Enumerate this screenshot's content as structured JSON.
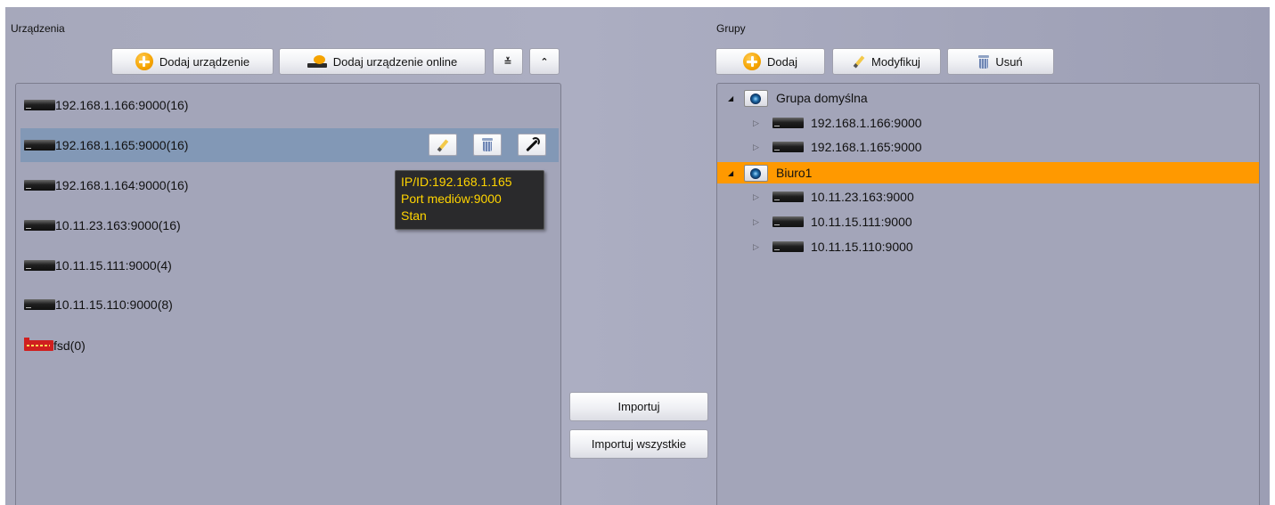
{
  "left": {
    "title": "Urządzenia",
    "add_device_label": "Dodaj urządzenie",
    "add_online_label": "Dodaj urządzenie online",
    "expand_glyph": "≚",
    "collapse_glyph": "⌃",
    "devices": [
      {
        "label": "192.168.1.166:9000(16)",
        "icon": "nvr-icon"
      },
      {
        "label": "192.168.1.165:9000(16)",
        "icon": "nvr-icon",
        "selected": true
      },
      {
        "label": "192.168.1.164:9000(16)",
        "icon": "nvr-icon"
      },
      {
        "label": "10.11.23.163:9000(16)",
        "icon": "nvr-icon"
      },
      {
        "label": "10.11.15.111:9000(4)",
        "icon": "nvr-icon"
      },
      {
        "label": "10.11.15.110:9000(8)",
        "icon": "nvr-icon"
      },
      {
        "label": "fsd(0)",
        "icon": "dvr-icon"
      }
    ],
    "tooltip": {
      "line1": "IP/ID:192.168.1.165",
      "line2": "Port mediów:9000",
      "line3": "Stan"
    }
  },
  "middle": {
    "import_label": "Importuj",
    "import_all_label": "Importuj wszystkie"
  },
  "right": {
    "title": "Grupy",
    "add_label": "Dodaj",
    "modify_label": "Modyfikuj",
    "delete_label": "Usuń",
    "groups": [
      {
        "name": "Grupa domyślna",
        "devices": [
          "192.168.1.166:9000",
          "192.168.1.165:9000"
        ]
      },
      {
        "name": "Biuro1",
        "selected": true,
        "devices": [
          "10.11.23.163:9000",
          "10.11.15.111:9000",
          "10.11.15.110:9000"
        ]
      }
    ]
  },
  "colors": {
    "selection_row": "#8298b6",
    "selected_group": "#ff9900",
    "tooltip_text": "#ffd400"
  }
}
